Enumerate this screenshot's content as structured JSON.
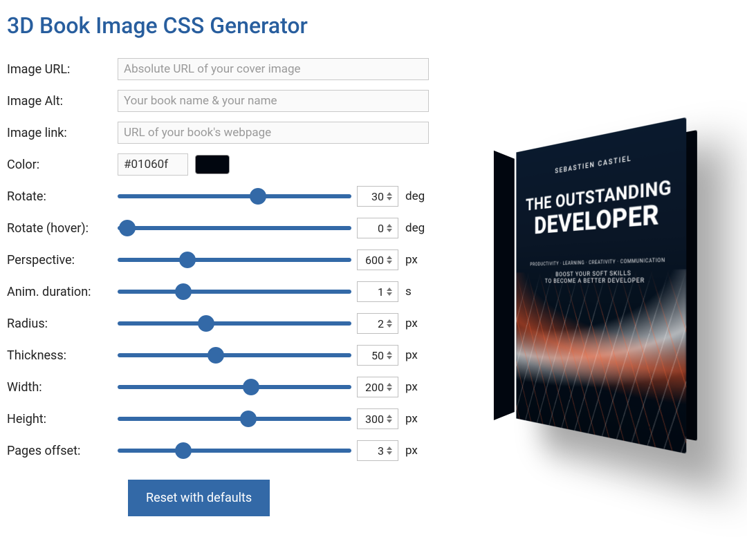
{
  "title": "3D Book Image CSS Generator",
  "fields": {
    "image_url": {
      "label": "Image URL:",
      "placeholder": "Absolute URL of your cover image",
      "value": ""
    },
    "image_alt": {
      "label": "Image Alt:",
      "placeholder": "Your book name & your name",
      "value": ""
    },
    "image_link": {
      "label": "Image link:",
      "placeholder": "URL of your book's webpage",
      "value": ""
    },
    "color": {
      "label": "Color:",
      "value": "#01060f"
    }
  },
  "sliders": {
    "rotate": {
      "label": "Rotate:",
      "value": 30,
      "unit": "deg",
      "pct": 60
    },
    "rotate_hover": {
      "label": "Rotate (hover):",
      "value": 0,
      "unit": "deg",
      "pct": 4
    },
    "perspective": {
      "label": "Perspective:",
      "value": 600,
      "unit": "px",
      "pct": 30
    },
    "anim_duration": {
      "label": "Anim. duration:",
      "value": 1,
      "unit": "s",
      "pct": 28
    },
    "radius": {
      "label": "Radius:",
      "value": 2,
      "unit": "px",
      "pct": 38
    },
    "thickness": {
      "label": "Thickness:",
      "value": 50,
      "unit": "px",
      "pct": 42
    },
    "width": {
      "label": "Width:",
      "value": 200,
      "unit": "px",
      "pct": 57
    },
    "height": {
      "label": "Height:",
      "value": 300,
      "unit": "px",
      "pct": 56
    },
    "pages_offset": {
      "label": "Pages offset:",
      "value": 3,
      "unit": "px",
      "pct": 28
    }
  },
  "reset_label": "Reset with defaults",
  "preview": {
    "author": "SEBASTIEN CASTIEL",
    "title_line1": "THE OUTSTANDING",
    "title_line2": "DEVELOPER",
    "tags": "PRODUCTIVITY · LEARNING · CREATIVITY · COMMUNICATION",
    "sub1": "BOOST YOUR SOFT SKILLS",
    "sub2": "TO BECOME A BETTER DEVELOPER"
  }
}
